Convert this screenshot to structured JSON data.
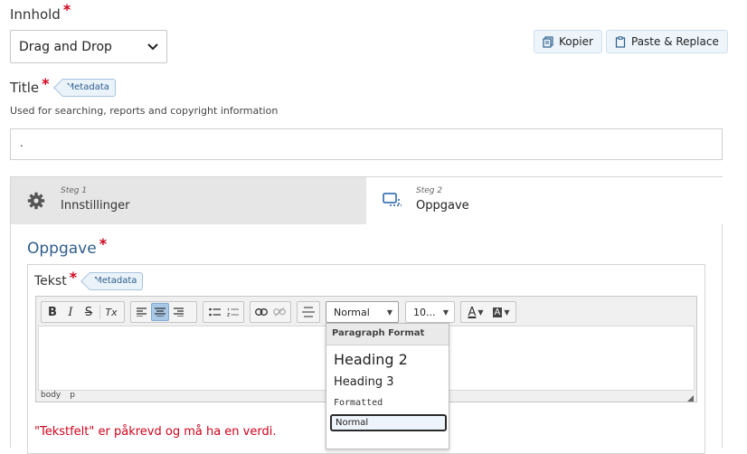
{
  "innhold": {
    "label": "Innhold",
    "required_mark": "*",
    "select_value": "Drag and Drop"
  },
  "actions": {
    "copy_label": "Kopier",
    "paste_label": "Paste & Replace"
  },
  "title_field": {
    "label": "Title",
    "required_mark": "*",
    "tag": "Metadata",
    "description": "Used for searching, reports and copyright information",
    "value": "."
  },
  "steps": [
    {
      "step_label": "Steg 1",
      "name": "Innstillinger",
      "icon": "gear-icon",
      "active": false
    },
    {
      "step_label": "Steg 2",
      "name": "Oppgave",
      "icon": "task-icon",
      "active": true
    }
  ],
  "oppgave": {
    "heading": "Oppgave",
    "required_mark": "*"
  },
  "tekst": {
    "label": "Tekst",
    "required_mark": "*",
    "tag": "Metadata"
  },
  "toolbar": {
    "bold": "B",
    "italic": "I",
    "strike": "S",
    "clear": "Tx",
    "format_value": "Normal",
    "size_value": "10...",
    "font_color": "A",
    "bg_color": "A"
  },
  "format_dropdown": {
    "header": "Paragraph Format",
    "options": [
      {
        "label": "Heading 2"
      },
      {
        "label": "Heading 3"
      },
      {
        "label": "Formatted"
      },
      {
        "label": "Normal"
      }
    ]
  },
  "status_path": [
    "body",
    "p"
  ],
  "error_message": "\"Tekstfelt\" er påkrevd og må ha en verdi.",
  "colors": {
    "required": "#d0021b",
    "heading_blue": "#2f5d8a",
    "active_toolbar": "#a9c8e8",
    "error": "#d0021b"
  }
}
